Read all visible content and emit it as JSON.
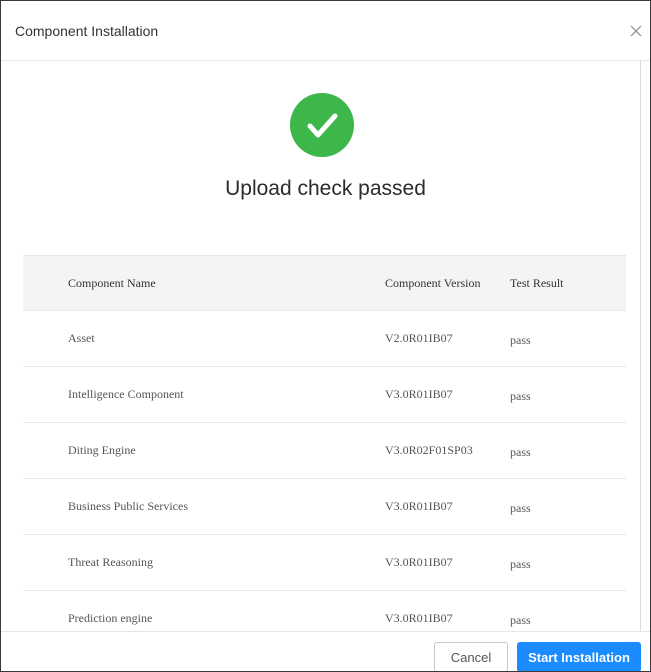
{
  "dialog": {
    "title": "Component Installation",
    "close_icon": "close-icon"
  },
  "status": {
    "icon": "check-circle-icon",
    "icon_color": "#3db74a",
    "title": "Upload check passed"
  },
  "table": {
    "headers": {
      "name": "Component Name",
      "version": "Component Version",
      "result": "Test Result"
    },
    "rows": [
      {
        "name": "Asset",
        "version": "V2.0R01IB07",
        "result": "pass"
      },
      {
        "name": "Intelligence Component",
        "version": "V3.0R01IB07",
        "result": "pass"
      },
      {
        "name": "Diting Engine",
        "version": "V3.0R02F01SP03",
        "result": "pass"
      },
      {
        "name": "Business Public Services",
        "version": "V3.0R01IB07",
        "result": "pass"
      },
      {
        "name": "Threat Reasoning",
        "version": "V3.0R01IB07",
        "result": "pass"
      },
      {
        "name": "Prediction engine",
        "version": "V3.0R01IB07",
        "result": "pass"
      }
    ]
  },
  "footer": {
    "cancel_label": "Cancel",
    "start_label": "Start Installation",
    "primary_color": "#1a8cff"
  }
}
